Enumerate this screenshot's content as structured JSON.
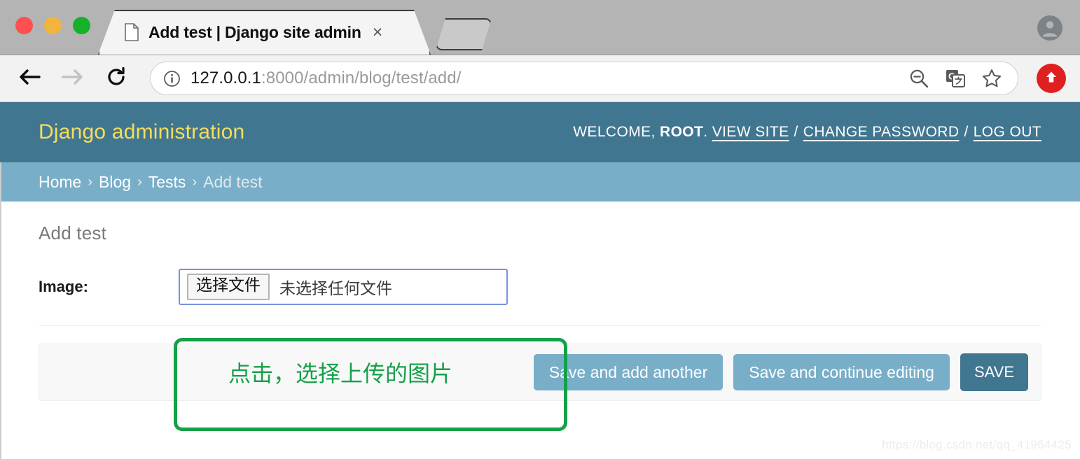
{
  "browser": {
    "tab": {
      "title": "Add test | Django site admin",
      "close_label": "×",
      "page_icon": "page-icon"
    },
    "new_tab_label": "",
    "nav": {
      "back": "back-arrow-icon",
      "forward": "forward-arrow-icon",
      "reload": "reload-icon"
    },
    "omnibox": {
      "info_icon": "site-info-icon",
      "url_host": "127.0.0.1",
      "url_path": ":8000/admin/blog/test/add/",
      "zoom_out_icon": "zoom-out-icon",
      "translate_icon": "translate-icon",
      "bookmark_icon": "star-icon"
    },
    "extension_icon": "upload-arrow-icon",
    "profile_icon": "account-circle-icon"
  },
  "django": {
    "brand": "Django administration",
    "usertools": {
      "welcome_prefix": "WELCOME,",
      "username": "ROOT",
      "period": ".",
      "view_site": "VIEW SITE",
      "change_password": "CHANGE PASSWORD",
      "log_out": "LOG OUT",
      "separator": "/"
    },
    "breadcrumbs": [
      {
        "label": "Home",
        "current": false
      },
      {
        "label": "Blog",
        "current": false
      },
      {
        "label": "Tests",
        "current": false
      },
      {
        "label": "Add test",
        "current": true
      }
    ],
    "breadcrumb_separator": "›",
    "heading": "Add test",
    "form": {
      "image_label": "Image:",
      "file_button": "选择文件",
      "file_status": "未选择任何文件"
    },
    "submit_row": {
      "save_and_add_another": "Save and add another",
      "save_and_continue": "Save and continue editing",
      "save": "SAVE"
    }
  },
  "annotations": {
    "callout_text": "点击，选择上传的图片",
    "box_color": "#15a04a",
    "text_color": "#15a04a"
  },
  "watermark": "https://blog.csdn.net/qq_41964425",
  "colors": {
    "header_teal": "#417690",
    "breadcrumb_blue": "#79aec8",
    "brand_yellow": "#f5dd5d",
    "focus_blue": "#7b90e0",
    "annotation_green": "#15a04a"
  }
}
